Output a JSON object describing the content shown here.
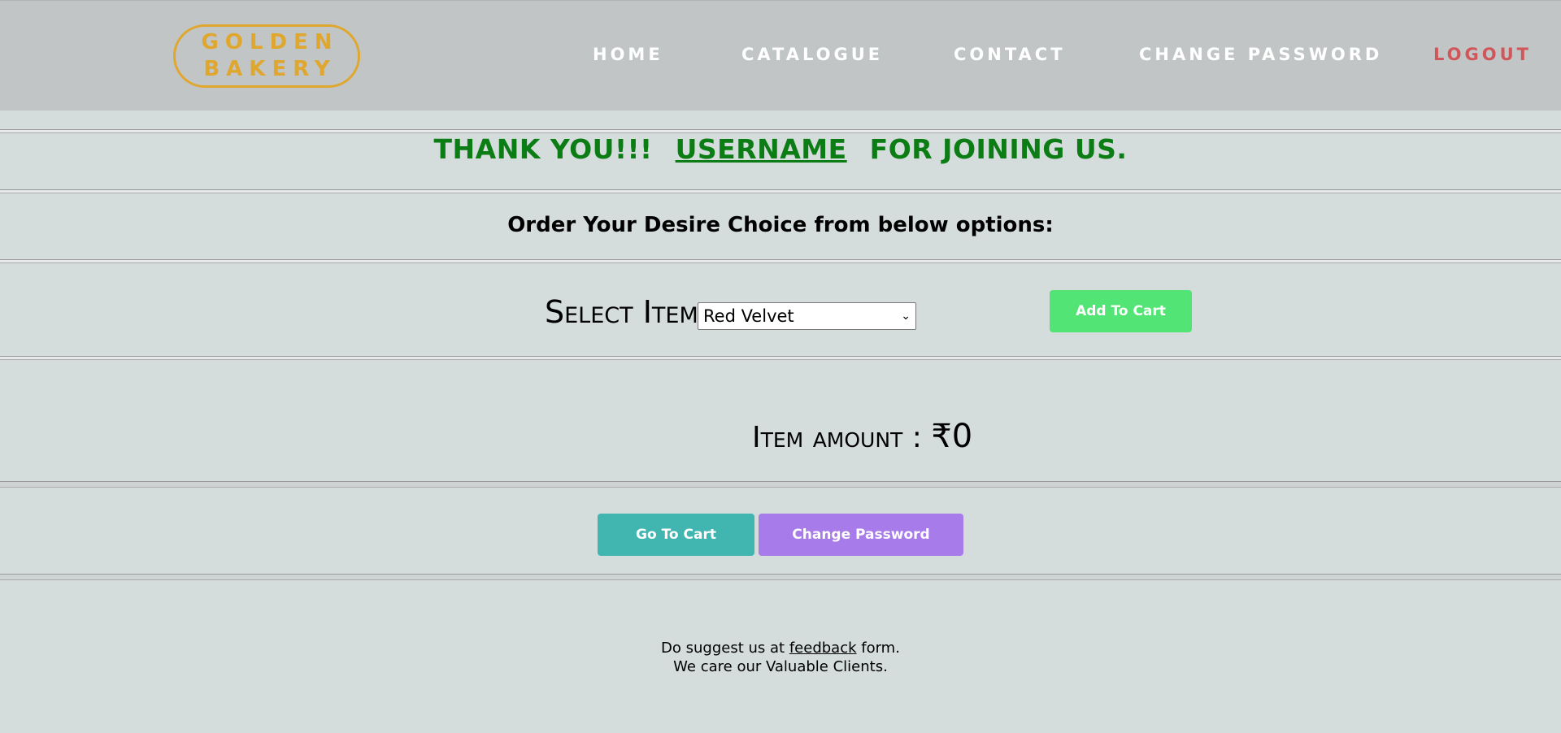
{
  "header": {
    "logo": {
      "line1": "GOLDEN",
      "line2": "BAKERY"
    },
    "nav": [
      {
        "label": "HOME"
      },
      {
        "label": "CATALOGUE"
      },
      {
        "label": "CONTACT"
      },
      {
        "label": "CHANGE PASSWORD"
      },
      {
        "label": "LOGOUT"
      }
    ]
  },
  "welcome": {
    "prefix": "THANK YOU!!!",
    "username": "USERNAME",
    "suffix": "FOR JOINING US."
  },
  "subtitle": "Order Your Desire Choice from below options:",
  "order": {
    "select_label": "Select Item :",
    "selected_item": "Red Velvet",
    "add_button": "Add To Cart"
  },
  "amount": {
    "label": "Item amount :",
    "value": "₹0"
  },
  "actions": {
    "go_to_cart": "Go To Cart",
    "change_password": "Change Password"
  },
  "footer": {
    "line1_prefix": "Do suggest us at",
    "line1_link": "feedback",
    "line1_suffix": "form.",
    "line2": "We care our Valuable Clients."
  },
  "colors": {
    "background": "#d4dcdc",
    "header_bg": "#c1c5c6",
    "logo": "#e0a72f",
    "logout": "#d0565a",
    "welcome": "#0b7d14",
    "add_button": "#52e474",
    "go_to_cart": "#41b6b1",
    "change_password": "#a77bea"
  }
}
